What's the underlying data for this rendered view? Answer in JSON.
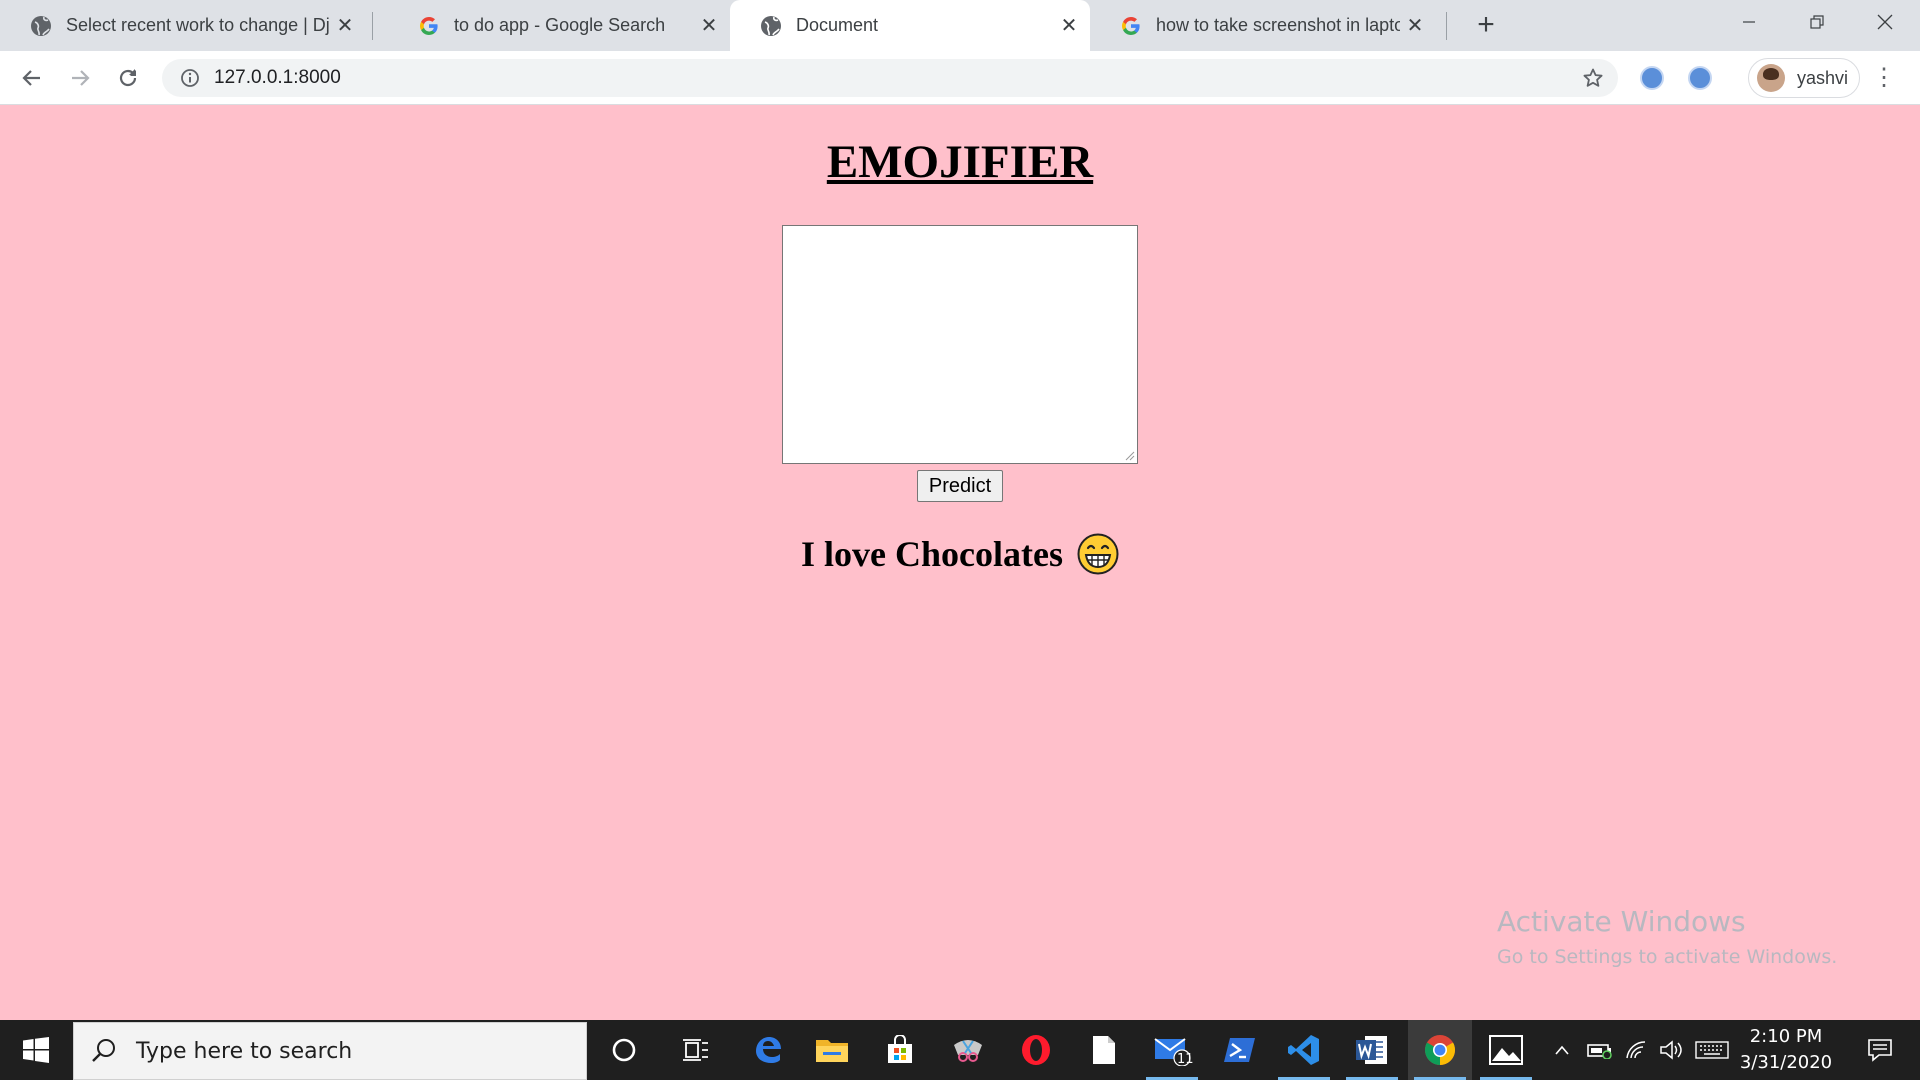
{
  "browser": {
    "tabs": [
      {
        "title": "Select recent work to change | Dj",
        "favicon": "globe-icon",
        "active": false
      },
      {
        "title": "to do app - Google Search",
        "favicon": "google-icon",
        "active": false
      },
      {
        "title": "Document",
        "favicon": "globe-icon",
        "active": true
      },
      {
        "title": "how to take screenshot in laptop",
        "favicon": "google-icon",
        "active": false
      }
    ],
    "url": "127.0.0.1:8000",
    "profile_name": "yashvi"
  },
  "page": {
    "heading": "EMOJIFIER",
    "textarea_value": "",
    "predict_label": "Predict",
    "result_text": "I love Chocolates",
    "result_emoji": "grinning-face-icon",
    "background_color": "#ffc0cb"
  },
  "watermark": {
    "line1": "Activate Windows",
    "line2": "Go to Settings to activate Windows."
  },
  "taskbar": {
    "search_placeholder": "Type here to search",
    "mail_badge": "11",
    "time": "2:10 PM",
    "date": "3/31/2020"
  }
}
